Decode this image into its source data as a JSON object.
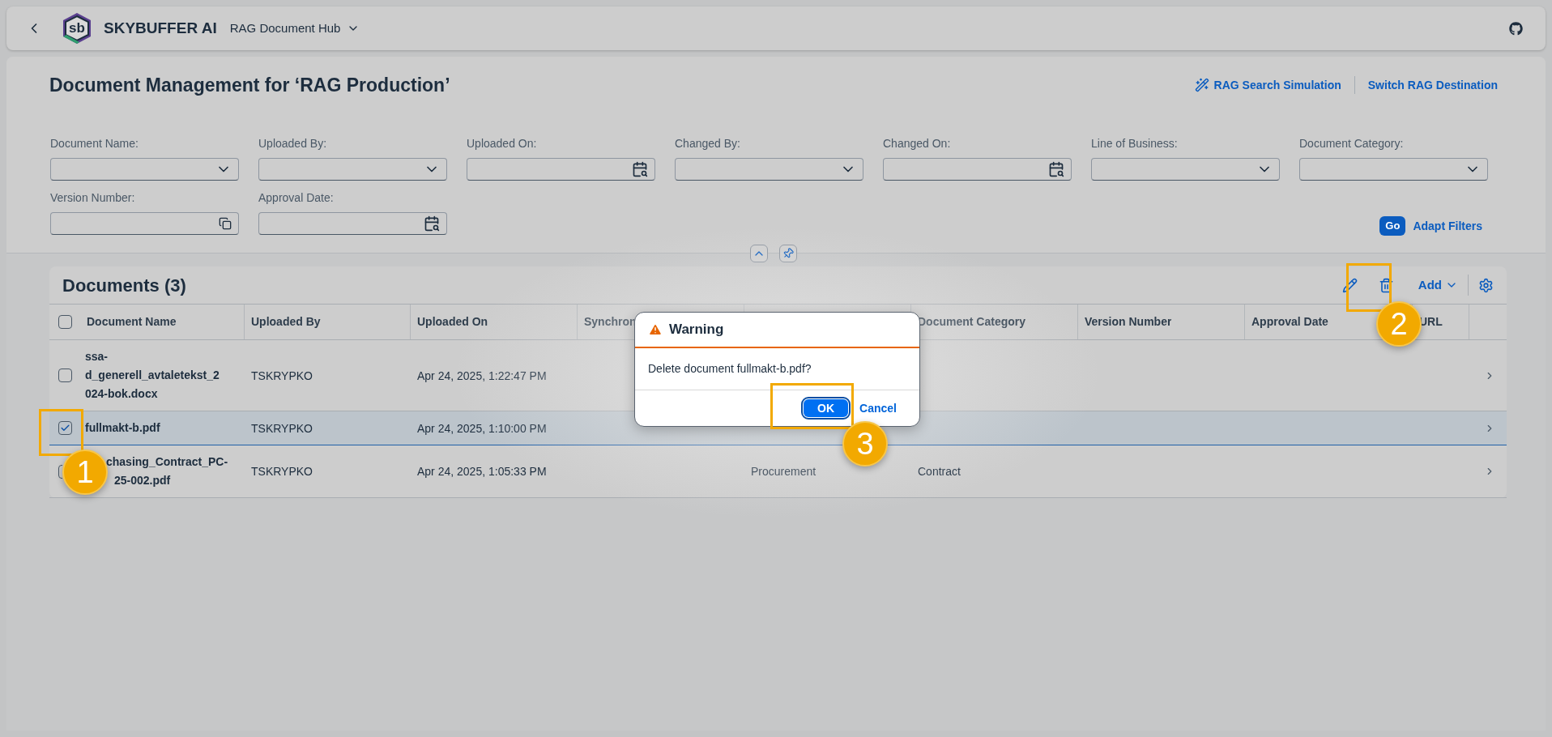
{
  "shell": {
    "logo_text": "sb",
    "brand": "SKYBUFFER AI",
    "app_title": "RAG Document Hub"
  },
  "page": {
    "title": "Document Management for ‘RAG Production’",
    "actions": [
      "RAG Search Simulation",
      "Switch RAG Destination"
    ]
  },
  "filters": [
    {
      "label": "Document Name:",
      "kind": "select"
    },
    {
      "label": "Uploaded By:",
      "kind": "select"
    },
    {
      "label": "Uploaded On:",
      "kind": "date"
    },
    {
      "label": "Changed By:",
      "kind": "select"
    },
    {
      "label": "Changed On:",
      "kind": "date"
    },
    {
      "label": "Line of Business:",
      "kind": "select"
    },
    {
      "label": "Document Category:",
      "kind": "select"
    },
    {
      "label": "Version Number:",
      "kind": "value_help"
    },
    {
      "label": "Approval Date:",
      "kind": "date"
    }
  ],
  "filter_buttons": {
    "go": "Go",
    "adapt": "Adapt Filters"
  },
  "table": {
    "title": "Documents (3)",
    "add": "Add",
    "select_all": false,
    "columns": [
      {
        "label": "Document Name"
      },
      {
        "label": "Uploaded By"
      },
      {
        "label": "Uploaded On"
      },
      {
        "label": "Synchron"
      },
      {},
      {
        "label": "Document Category"
      },
      {
        "label": "Version Number"
      },
      {
        "label": "Approval Date"
      },
      {
        "label": "URL"
      }
    ],
    "rows": [
      {
        "selected": false,
        "name": "ssa-d_generell_avtaletekst_2024-bok.docx",
        "uploaded_by": "TSKRYPKO",
        "uploaded_on": "Apr 24, 2025, 1:22:47 PM"
      },
      {
        "selected": true,
        "name": "fullmakt-b.pdf",
        "uploaded_by": "TSKRYPKO",
        "uploaded_on": "Apr 24, 2025, 1:10:00 PM"
      },
      {
        "selected": false,
        "name_lines": [
          "chasing_Contract_PC-",
          "25-002.pdf"
        ],
        "uploaded_by": "TSKRYPKO",
        "uploaded_on": "Apr 24, 2025, 1:05:33 PM",
        "column_5": "Procurement",
        "document_category": "Contract"
      }
    ]
  },
  "dialog": {
    "title": "Warning",
    "message": "Delete document fullmakt-b.pdf?",
    "buttons": [
      {
        "label": "OK",
        "kind": "emphasized"
      },
      {
        "label": "Cancel",
        "kind": "transparent"
      }
    ]
  },
  "callouts": [
    {
      "label": "1"
    },
    {
      "label": "2"
    },
    {
      "label": "3"
    }
  ]
}
